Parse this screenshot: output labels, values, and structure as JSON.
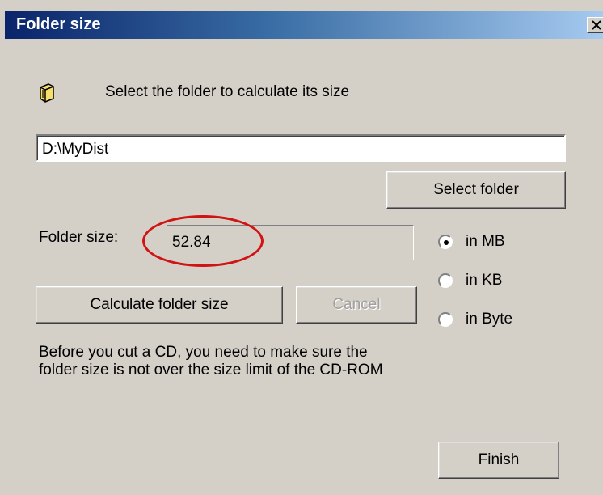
{
  "window": {
    "title": "Folder size"
  },
  "prompt": "Select the folder to calculate its size",
  "folder_path": {
    "value": "D:\\MyDist"
  },
  "select_folder_label": "Select folder",
  "folder_size": {
    "label": "Folder size:",
    "value": "52.84"
  },
  "units": {
    "mb": "in MB",
    "kb": "in KB",
    "byte": "in Byte",
    "selected": "mb"
  },
  "calculate_label": "Calculate folder size",
  "cancel_label": "Cancel",
  "note": "Before you cut a CD, you need to make sure the folder size is not over the size limit of the CD-ROM",
  "finish_label": "Finish",
  "colors": {
    "highlight": "#d01414",
    "titlebar": "#0a246a"
  }
}
